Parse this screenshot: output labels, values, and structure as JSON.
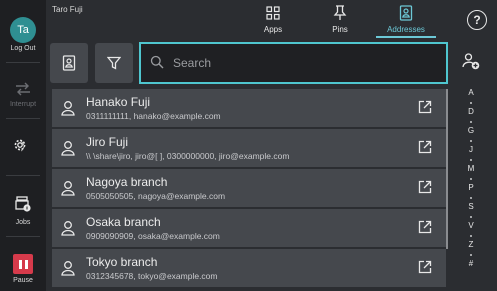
{
  "user": {
    "name": "Taro Fuji",
    "initials": "Ta"
  },
  "rail": {
    "logout_label": "Log Out",
    "interrupt_label": "Interrupt",
    "jobs_label": "Jobs",
    "pause_label": "Pause",
    "settings_chevron": "〉"
  },
  "tabs": [
    {
      "label": "Apps",
      "icon": "apps-grid-icon",
      "active": false
    },
    {
      "label": "Pins",
      "icon": "pin-icon",
      "active": false
    },
    {
      "label": "Addresses",
      "icon": "address-book-icon",
      "active": true
    }
  ],
  "help_label": "?",
  "search": {
    "placeholder": "Search",
    "value": ""
  },
  "contacts": [
    {
      "name": "Hanako Fuji",
      "detail": "0311111111, hanako@example.com"
    },
    {
      "name": "Jiro Fuji",
      "detail": "\\\\            \\share\\jiro, jiro@[            ], 0300000000, jiro@example.com"
    },
    {
      "name": "Nagoya branch",
      "detail": "0505050505, nagoya@example.com"
    },
    {
      "name": "Osaka branch",
      "detail": "0909090909, osaka@example.com"
    },
    {
      "name": "Tokyo branch",
      "detail": "0312345678, tokyo@example.com"
    }
  ],
  "alphabet_index": [
    "A",
    "D",
    "G",
    "J",
    "M",
    "P",
    "S",
    "V",
    "Z",
    "#"
  ],
  "colors": {
    "accent": "#4fc6cf",
    "pause": "#d63a4b",
    "avatar": "#2f8f92"
  }
}
